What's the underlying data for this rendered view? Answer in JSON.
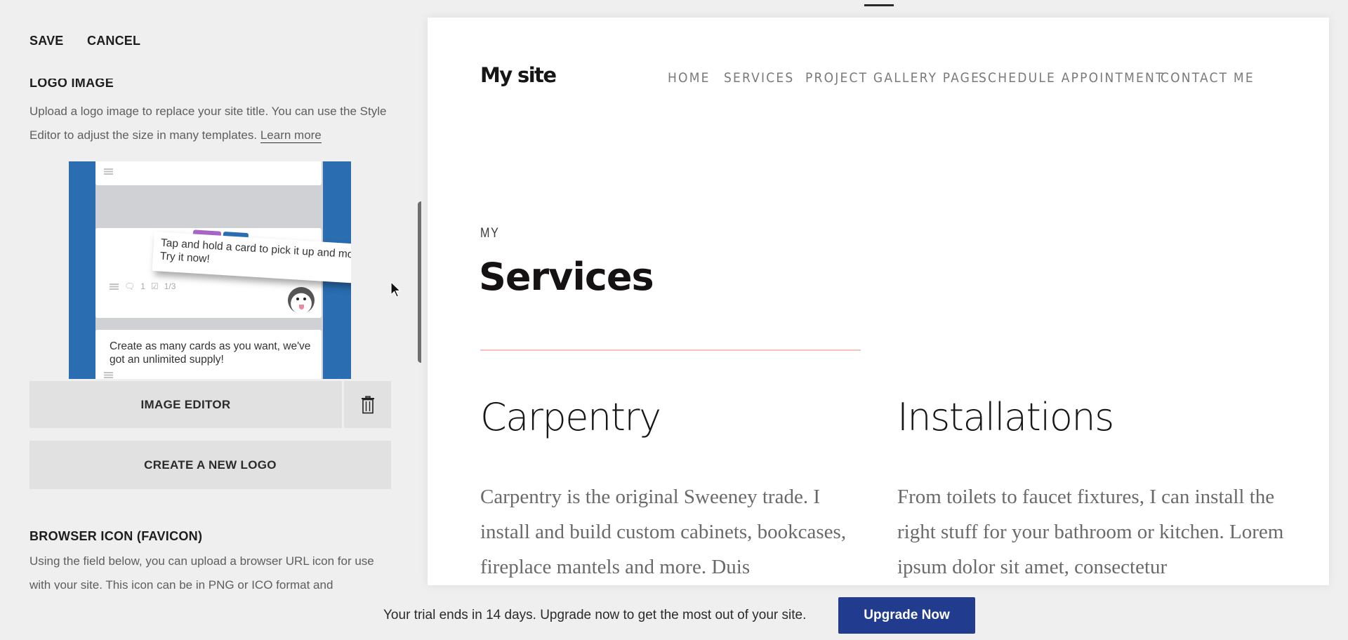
{
  "editor": {
    "header": {
      "save_label": "SAVE",
      "cancel_label": "CANCEL"
    },
    "logo_section": {
      "heading": "LOGO IMAGE",
      "description": "Upload a logo image to replace your site title. You can use the Style Editor to adjust the size in many templates. ",
      "learn_more_label": "Learn more",
      "thumbnail": {
        "tooltip_text": "Tap and hold a card to pick it up and move it. Try it now!",
        "card_text": "Create as many cards as you want, we've got an unlimited supply!",
        "comment_count": "1",
        "checklist": "1/3"
      },
      "image_editor_label": "IMAGE EDITOR",
      "delete_icon": "trash-icon",
      "create_logo_label": "CREATE A NEW LOGO"
    },
    "favicon_section": {
      "heading": "BROWSER ICON (FAVICON)",
      "description": "Using the field below, you can upload a browser URL icon for use with your site. This icon can be in PNG or ICO format and"
    }
  },
  "preview": {
    "site_title": "My site",
    "nav": [
      {
        "label": "HOME"
      },
      {
        "label": "SERVICES"
      },
      {
        "label": "PROJECT GALLERY PAGE"
      },
      {
        "label": "SCHEDULE APPOINTMENT"
      },
      {
        "label": "CONTACT ME"
      }
    ],
    "kicker": "MY",
    "page_title": "Services",
    "rule_color": "#f2c4bc",
    "services": [
      {
        "title": "Carpentry",
        "body": "Carpentry is the original Sweeney trade. I install and build custom cabinets, bookcases, fireplace mantels and more. Duis"
      },
      {
        "title": "Installations",
        "body": "From toilets to faucet fixtures, I can install the right stuff for your bathroom or kitchen. Lorem ipsum dolor sit amet, consectetur"
      }
    ]
  },
  "trial_bar": {
    "message": "Your trial ends in 14 days. Upgrade now to get the most out of your site.",
    "upgrade_label": "Upgrade Now",
    "upgrade_color": "#213c8f"
  }
}
